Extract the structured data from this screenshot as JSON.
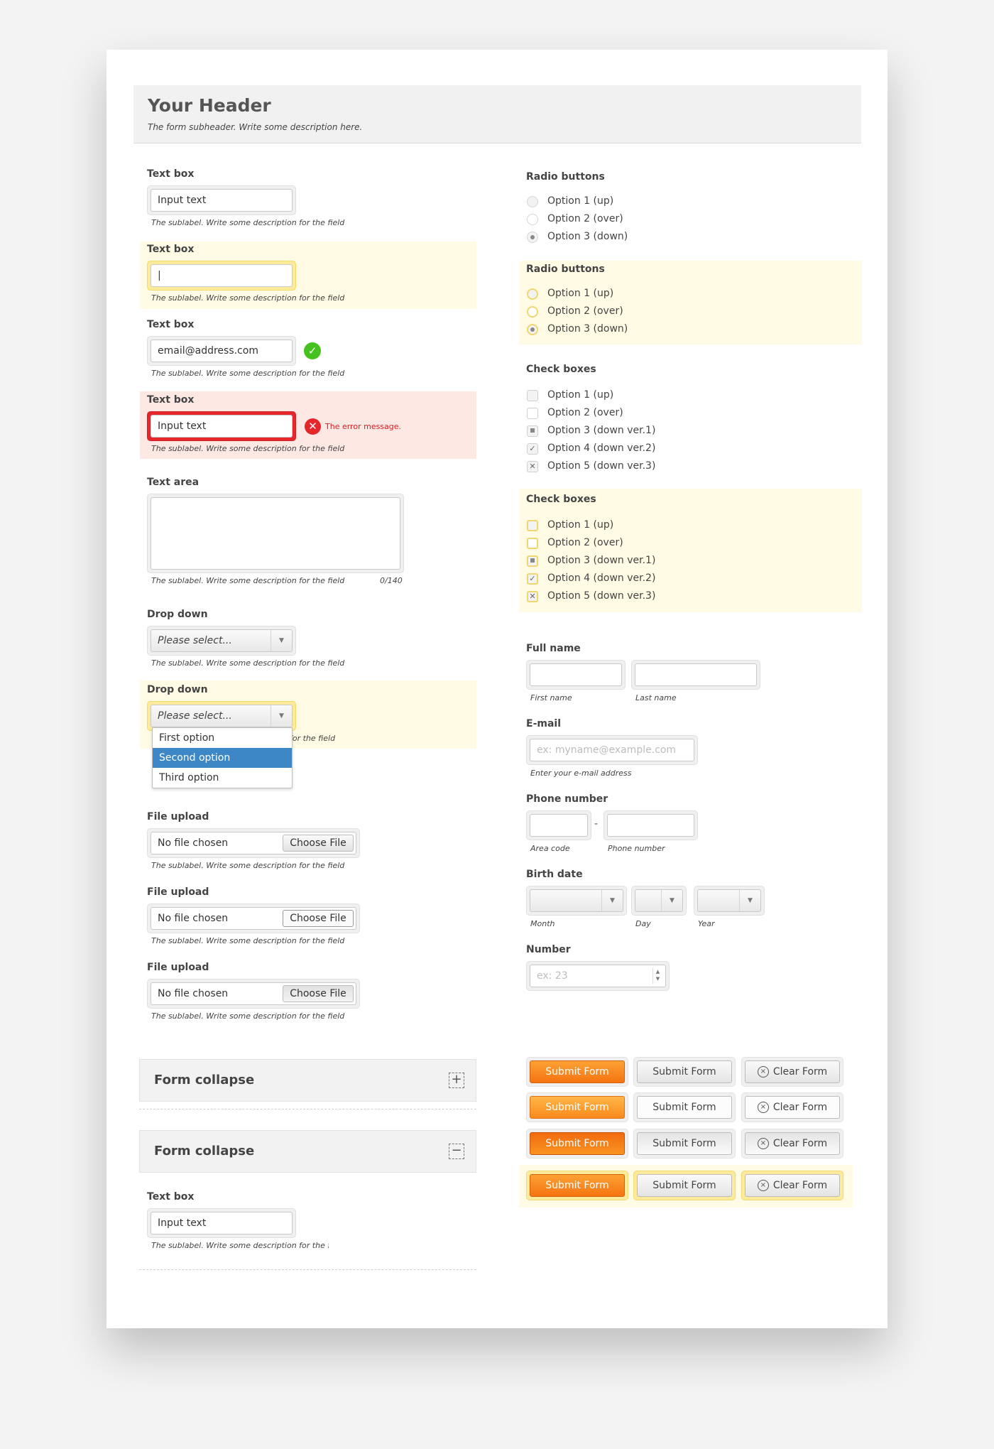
{
  "header": {
    "title": "Your Header",
    "subtitle": "The form subheader. Write some description here."
  },
  "sublabel": "The sublabel. Write some description for the field",
  "sublabel_cut": "The sublabel. Write some description for the fiel",
  "left": {
    "textbox1": {
      "label": "Text box",
      "value": "Input text"
    },
    "textbox2": {
      "label": "Text box",
      "value": "|"
    },
    "textbox3": {
      "label": "Text box",
      "value": "email@address.com"
    },
    "textbox4": {
      "label": "Text box",
      "value": "Input text",
      "error": "The error message."
    },
    "textarea": {
      "label": "Text area",
      "counter": "0/140"
    },
    "dropdown1": {
      "label": "Drop down",
      "value": "Please select..."
    },
    "dropdown2": {
      "label": "Drop down",
      "value": "Please select...",
      "options": [
        "First option",
        "Second option",
        "Third option"
      ],
      "sub_visible": "for the field"
    },
    "file1": {
      "label": "File upload",
      "value": "No file chosen",
      "button": "Choose File"
    },
    "file2": {
      "label": "File upload",
      "value": "No file chosen",
      "button": "Choose File"
    },
    "file3": {
      "label": "File upload",
      "value": "No file chosen",
      "button": "Choose File"
    },
    "collapse1": {
      "title": "Form collapse",
      "icon": "+"
    },
    "collapse2": {
      "title": "Form collapse",
      "icon": "−"
    },
    "textbox5": {
      "label": "Text box",
      "value": "Input text"
    }
  },
  "right": {
    "radio1": {
      "label": "Radio buttons",
      "options": [
        "Option 1 (up)",
        "Option 2 (over)",
        "Option 3 (down)"
      ]
    },
    "radio2": {
      "label": "Radio buttons",
      "options": [
        "Option 1 (up)",
        "Option 2 (over)",
        "Option 3 (down)"
      ]
    },
    "check1": {
      "label": "Check boxes",
      "options": [
        "Option 1 (up)",
        "Option 2 (over)",
        "Option 3 (down ver.1)",
        "Option 4 (down ver.2)",
        "Option 5 (down ver.3)"
      ]
    },
    "check2": {
      "label": "Check boxes",
      "options": [
        "Option 1 (up)",
        "Option 2 (over)",
        "Option 3 (down ver.1)",
        "Option 4 (down ver.2)",
        "Option 5 (down ver.3)"
      ]
    },
    "fullname": {
      "label": "Full name",
      "first": "First name",
      "last": "Last name"
    },
    "email": {
      "label": "E-mail",
      "placeholder": "ex: myname@example.com",
      "hint": "Enter your e-mail address"
    },
    "phone": {
      "label": "Phone number",
      "area": "Area code",
      "number": "Phone number",
      "sep": "-"
    },
    "birth": {
      "label": "Birth date",
      "month": "Month",
      "day": "Day",
      "year": "Year"
    },
    "number": {
      "label": "Number",
      "placeholder": "ex: 23"
    }
  },
  "buttons": {
    "submit": "Submit Form",
    "clear": "Clear Form",
    "clear_icon": "×"
  }
}
